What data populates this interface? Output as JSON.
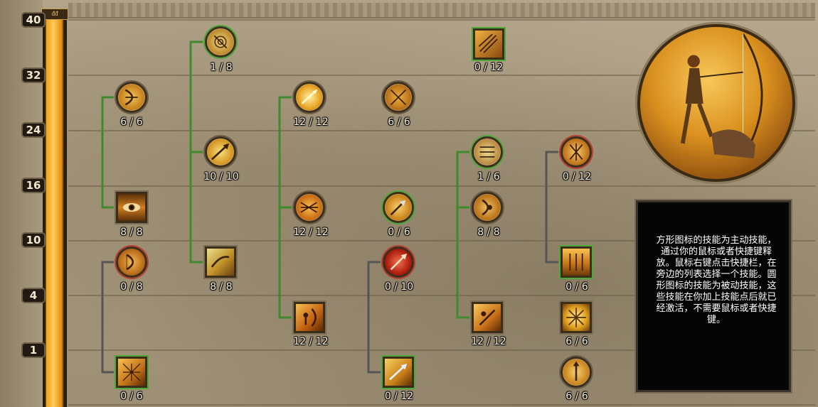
{
  "level_markers": [
    "40",
    "32",
    "24",
    "16",
    "10",
    "4",
    "1"
  ],
  "bar_cap_label": "ᵭᵭ",
  "skills": [
    {
      "name": "piercing-arrow-skill",
      "shape": "round",
      "count": "1 / 8"
    },
    {
      "name": "arrow-volley-skill",
      "shape": "square",
      "count": "0 / 12"
    },
    {
      "name": "bow-draw-skill",
      "shape": "round",
      "count": "6 / 6"
    },
    {
      "name": "quick-shot-skill",
      "shape": "round",
      "count": "12 / 12"
    },
    {
      "name": "crossed-arrows-skill",
      "shape": "round",
      "count": "6 / 6"
    },
    {
      "name": "sharp-arrow-skill",
      "shape": "round",
      "count": "10 / 10"
    },
    {
      "name": "hunter-eye-skill",
      "shape": "square",
      "count": "8 / 8"
    },
    {
      "name": "multi-arrow-skill",
      "shape": "round",
      "count": "12 / 12"
    },
    {
      "name": "arrow-strike-skill",
      "shape": "round",
      "count": "0 / 6"
    },
    {
      "name": "archer-focus-skill",
      "shape": "round",
      "count": "8 / 8"
    },
    {
      "name": "camouflage-skill",
      "shape": "round",
      "count": "1 / 6"
    },
    {
      "name": "crossed-blades-skill",
      "shape": "round",
      "count": "0 / 12"
    },
    {
      "name": "bow-mastery-skill",
      "shape": "round",
      "count": "0 / 8"
    },
    {
      "name": "wind-arrow-skill",
      "shape": "square",
      "count": "8 / 8"
    },
    {
      "name": "blood-arrow-skill",
      "shape": "round",
      "count": "0 / 10"
    },
    {
      "name": "arrow-rain-skill",
      "shape": "square",
      "count": "0 / 6"
    },
    {
      "name": "hunter-aim-skill",
      "shape": "square",
      "count": "12 / 12"
    },
    {
      "name": "ranger-shot-skill",
      "shape": "square",
      "count": "12 / 12"
    },
    {
      "name": "nature-burst-skill",
      "shape": "square",
      "count": "6 / 6"
    },
    {
      "name": "snare-net-skill",
      "shape": "square",
      "count": "0 / 6"
    },
    {
      "name": "ice-arrow-skill",
      "shape": "square",
      "count": "0 / 12"
    },
    {
      "name": "spear-throw-skill",
      "shape": "round",
      "count": "6 / 6"
    }
  ],
  "tooltip": {
    "text": "方形图标的技能为主动技能，通过你的鼠标或者快捷键释放。鼠标右键点击快捷栏，在旁边的列表选择一个技能。圆形图标的技能为被动技能，这些技能在你加上技能点后就已经激活，不需要鼠标或者快捷键。"
  },
  "colors": {
    "connector_active": "#3e8a2c",
    "connector_inactive": "#555555",
    "skill_highlight": "#4fa83a",
    "level_bar": "#f0a020"
  }
}
